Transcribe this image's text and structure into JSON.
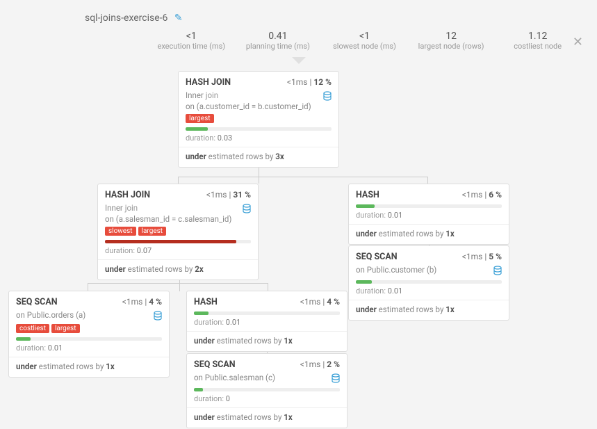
{
  "title": "sql-joins-exercise-6",
  "stats": [
    {
      "v": "<1",
      "l": "execution time (ms)"
    },
    {
      "v": "0.41",
      "l": "planning time (ms)"
    },
    {
      "v": "<1",
      "l": "slowest node (ms)"
    },
    {
      "v": "12",
      "l": "largest node (rows)"
    },
    {
      "v": "1.12",
      "l": "costliest node"
    }
  ],
  "nodes": {
    "n1": {
      "title": "HASH JOIN",
      "time": "<1ms",
      "pct": "12",
      "join": "Inner",
      "jt": "join",
      "cond": "on (a.customer_id = b.customer_id)",
      "tags": [
        "largest"
      ],
      "barColor": "#5cb85c",
      "barW": "15%",
      "dur": "0.03",
      "est": "3x"
    },
    "n2": {
      "title": "HASH JOIN",
      "time": "<1ms",
      "pct": "31",
      "join": "Inner",
      "jt": "join",
      "cond": "on (a.salesman_id = c.salesman_id)",
      "tags": [
        "slowest",
        "largest"
      ],
      "barColor": "#b52e1f",
      "barW": "90%",
      "dur": "0.07",
      "est": "2x"
    },
    "n3": {
      "title": "HASH",
      "time": "<1ms",
      "pct": "6",
      "barColor": "#5cb85c",
      "barW": "13%",
      "dur": "0.01",
      "est": "1x"
    },
    "n4": {
      "title": "SEQ SCAN",
      "time": "<1ms",
      "pct": "5",
      "sub": "on Public.customer (b)",
      "barColor": "#5cb85c",
      "barW": "11%",
      "dur": "0.01",
      "est": "1x"
    },
    "n5": {
      "title": "SEQ SCAN",
      "time": "<1ms",
      "pct": "4",
      "sub": "on Public.orders (a)",
      "tags": [
        "costliest",
        "largest"
      ],
      "barColor": "#5cb85c",
      "barW": "10%",
      "dur": "0.01",
      "est": "1x"
    },
    "n6": {
      "title": "HASH",
      "time": "<1ms",
      "pct": "4",
      "barColor": "#5cb85c",
      "barW": "10%",
      "dur": "0.01",
      "est": "1x"
    },
    "n7": {
      "title": "SEQ SCAN",
      "time": "<1ms",
      "pct": "2",
      "sub": "on Public.salesman (c)",
      "barColor": "#5cb85c",
      "barW": "6%",
      "dur": "0",
      "est": "1x"
    }
  },
  "labels": {
    "duration": "duration:",
    "under": "under",
    "estRows": "estimated rows by"
  }
}
